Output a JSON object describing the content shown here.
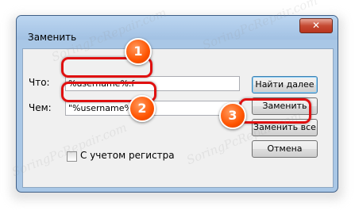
{
  "dialog": {
    "title": "Заменить",
    "close_glyph": "✕"
  },
  "find": {
    "label": "Что:",
    "value": "%username%.f"
  },
  "replace": {
    "label": "Чем:",
    "value": "\"%username%\".f"
  },
  "buttons": {
    "find_next": "Найти далее",
    "replace": "Заменить",
    "replace_all": "Заменить все",
    "cancel": "Отмена"
  },
  "match_case_label": "С учетом регистра",
  "markers": [
    "1",
    "2",
    "3"
  ],
  "watermark": "SoringPcRepair.com",
  "colors": {
    "highlight": "#e01010",
    "marker": "#ff6a13",
    "window_frame": "#a9c7e6"
  }
}
